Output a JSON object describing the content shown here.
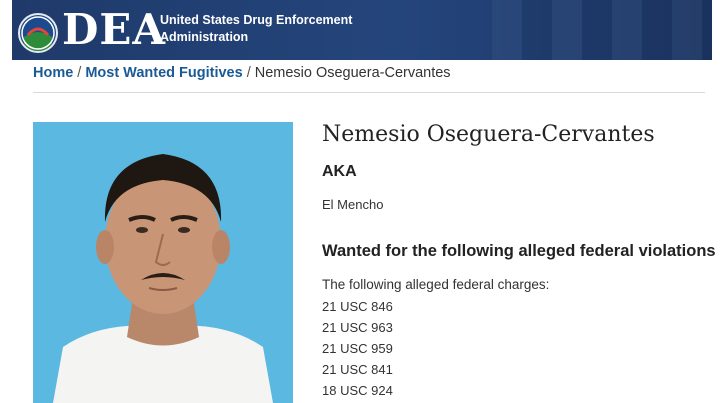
{
  "header": {
    "logo_text": "DEA",
    "agency_line1": "United States Drug Enforcement",
    "agency_line2": "Administration",
    "bg_color": "#24457c"
  },
  "breadcrumb": {
    "items": [
      {
        "label": "Home",
        "link": true
      },
      {
        "label": "Most Wanted Fugitives",
        "link": true
      },
      {
        "label": "Nemesio Oseguera-Cervantes",
        "link": false
      }
    ],
    "separator": "/",
    "link_color": "#1a5a96"
  },
  "fugitive": {
    "name": "Nemesio Oseguera-Cervantes",
    "aka_label": "AKA",
    "alias": "El Mencho",
    "violations_heading": "Wanted for the following alleged federal violations",
    "charges_intro": "The following alleged federal charges:",
    "charges": [
      "21 USC 846",
      "21 USC 963",
      "21 USC 959",
      "21 USC 841",
      "18 USC 924"
    ],
    "photo_bg_color": "#5bb8e0"
  }
}
